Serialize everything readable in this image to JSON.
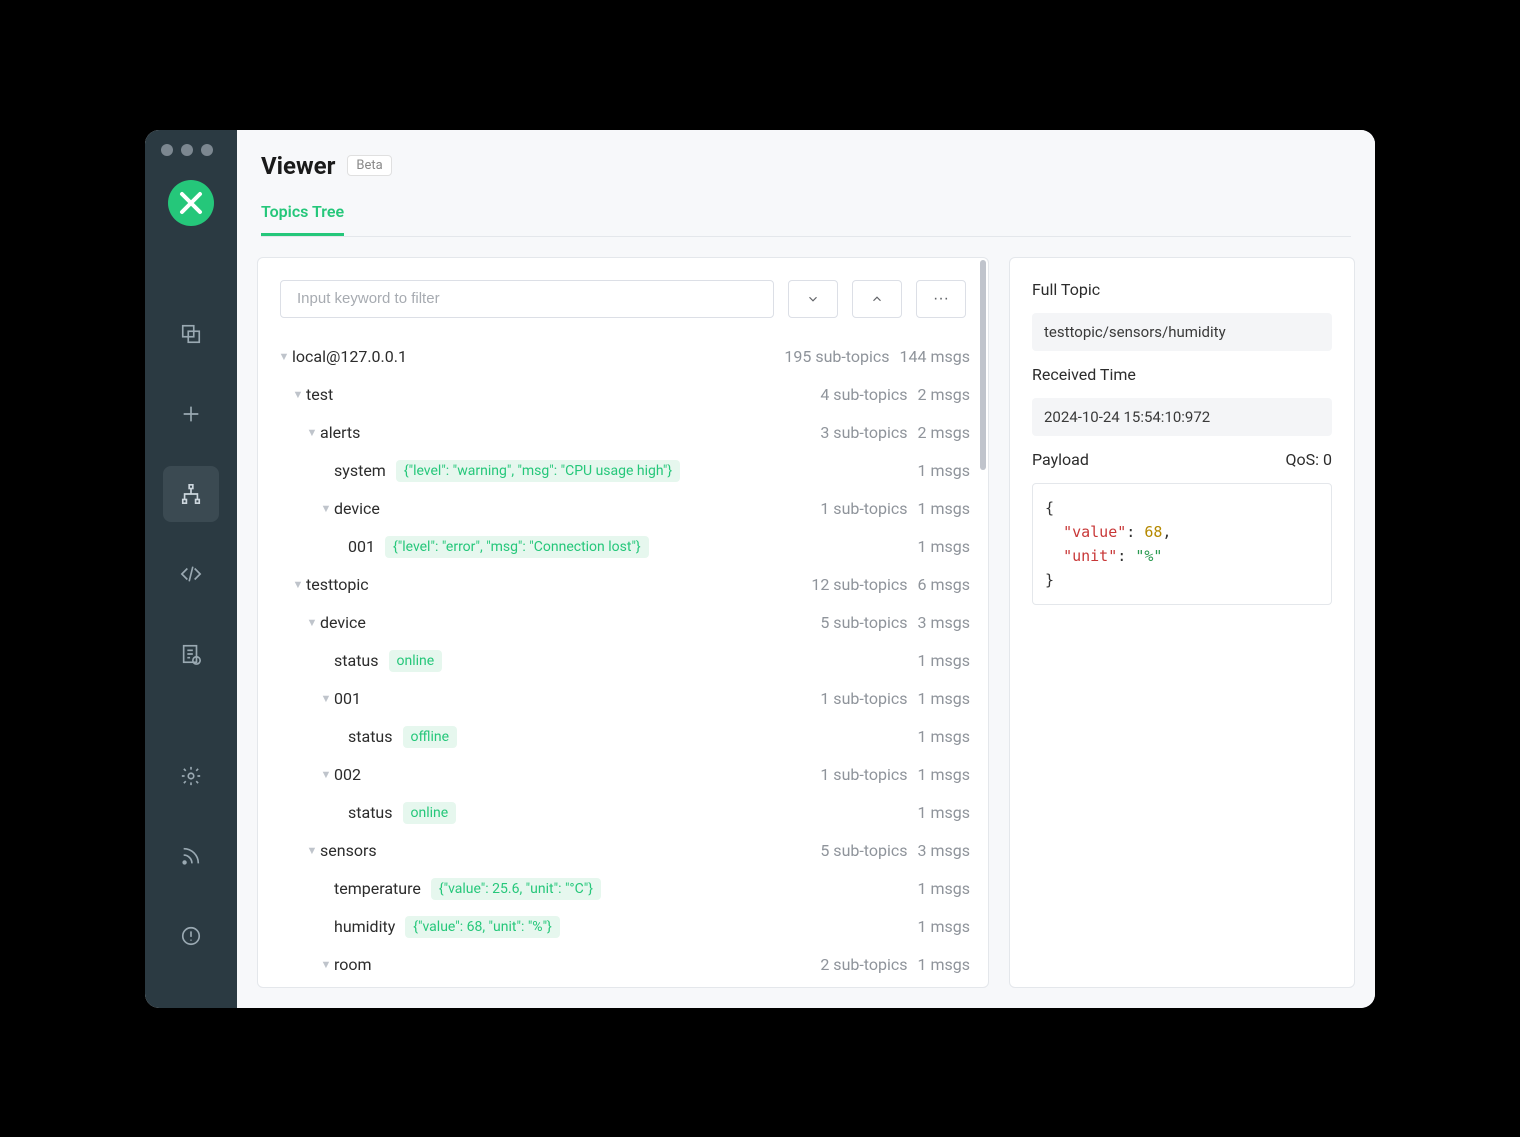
{
  "header": {
    "title": "Viewer",
    "badge": "Beta",
    "tab": "Topics Tree"
  },
  "filter": {
    "placeholder": "Input keyword to filter"
  },
  "tree": [
    {
      "depth": 0,
      "name": "local@127.0.0.1",
      "expandable": true,
      "sub": "195 sub-topics",
      "msgs": "144 msgs"
    },
    {
      "depth": 1,
      "name": "test",
      "expandable": true,
      "sub": "4 sub-topics",
      "msgs": "2 msgs"
    },
    {
      "depth": 2,
      "name": "alerts",
      "expandable": true,
      "sub": "3 sub-topics",
      "msgs": "2 msgs"
    },
    {
      "depth": 3,
      "name": "system",
      "tag": "{\"level\": \"warning\", \"msg\": \"CPU usage high\"}",
      "msgs": "1 msgs"
    },
    {
      "depth": 3,
      "name": "device",
      "expandable": true,
      "sub": "1 sub-topics",
      "msgs": "1 msgs"
    },
    {
      "depth": 4,
      "name": "001",
      "tag": "{\"level\": \"error\", \"msg\": \"Connection lost\"}",
      "msgs": "1 msgs"
    },
    {
      "depth": 1,
      "name": "testtopic",
      "expandable": true,
      "sub": "12 sub-topics",
      "msgs": "6 msgs"
    },
    {
      "depth": 2,
      "name": "device",
      "expandable": true,
      "sub": "5 sub-topics",
      "msgs": "3 msgs"
    },
    {
      "depth": 3,
      "name": "status",
      "tag": "online",
      "msgs": "1 msgs"
    },
    {
      "depth": 3,
      "name": "001",
      "expandable": true,
      "sub": "1 sub-topics",
      "msgs": "1 msgs"
    },
    {
      "depth": 4,
      "name": "status",
      "tag": "offline",
      "msgs": "1 msgs"
    },
    {
      "depth": 3,
      "name": "002",
      "expandable": true,
      "sub": "1 sub-topics",
      "msgs": "1 msgs"
    },
    {
      "depth": 4,
      "name": "status",
      "tag": "online",
      "msgs": "1 msgs"
    },
    {
      "depth": 2,
      "name": "sensors",
      "expandable": true,
      "sub": "5 sub-topics",
      "msgs": "3 msgs"
    },
    {
      "depth": 3,
      "name": "temperature",
      "tag": "{\"value\": 25.6, \"unit\": \"°C\"}",
      "msgs": "1 msgs"
    },
    {
      "depth": 3,
      "name": "humidity",
      "tag": "{\"value\": 68, \"unit\": \"%\"}",
      "msgs": "1 msgs"
    },
    {
      "depth": 3,
      "name": "room",
      "expandable": true,
      "sub": "2 sub-topics",
      "msgs": "1 msgs"
    }
  ],
  "detail": {
    "full_topic_label": "Full Topic",
    "full_topic": "testtopic/sensors/humidity",
    "received_label": "Received Time",
    "received_time": "2024-10-24 15:54:10:972",
    "payload_label": "Payload",
    "qos_label": "QoS: 0",
    "payload": {
      "value": 68,
      "unit": "%"
    }
  },
  "payload_display": {
    "open": "{",
    "key1": "\"value\"",
    "colon": ": ",
    "val1": "68",
    "comma": ",",
    "key2": "\"unit\"",
    "val2": "\"%\"",
    "close": "}"
  }
}
